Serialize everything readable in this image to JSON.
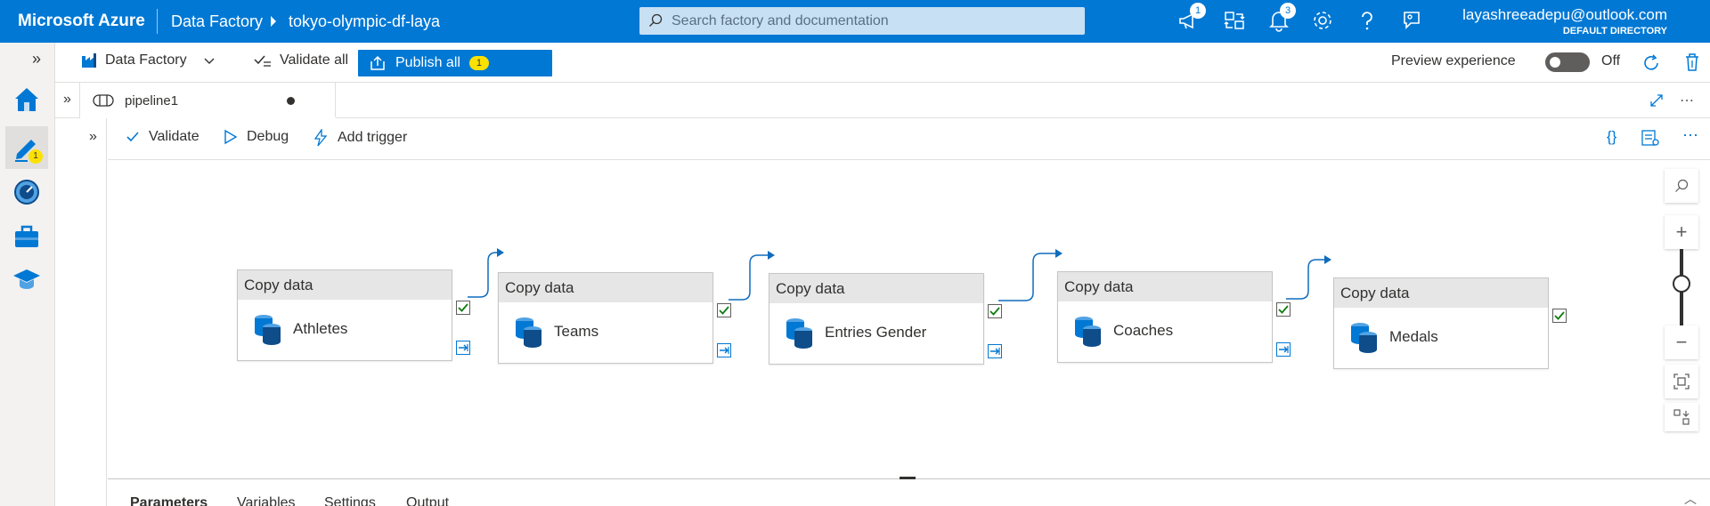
{
  "topbar": {
    "brand": "Microsoft Azure",
    "breadcrumb": [
      "Data Factory",
      "tokyo-olympic-df-laya"
    ],
    "search_placeholder": "Search factory and documentation",
    "notifications": {
      "updates_badge": "1",
      "bell_badge": "3"
    },
    "account": {
      "email": "layashreeadepu@outlook.com",
      "directory": "DEFAULT DIRECTORY"
    }
  },
  "rail": {
    "expand": "»",
    "items": [
      {
        "name": "home",
        "badge": ""
      },
      {
        "name": "author",
        "badge": "1"
      },
      {
        "name": "monitor",
        "badge": ""
      },
      {
        "name": "manage",
        "badge": ""
      },
      {
        "name": "learning-center",
        "badge": ""
      }
    ]
  },
  "commandbar": {
    "factory_label": "Data Factory",
    "validate_all": "Validate all",
    "publish_all": "Publish all",
    "publish_badge": "1",
    "preview_label": "Preview experience",
    "preview_state": "Off"
  },
  "tabs": {
    "expand": "»",
    "active_tab": "pipeline1"
  },
  "canvas_toolbar": {
    "expand": "»",
    "validate": "Validate",
    "debug": "Debug",
    "add_trigger": "Add trigger"
  },
  "activities": [
    {
      "type": "Copy data",
      "name": "Athletes"
    },
    {
      "type": "Copy data",
      "name": "Teams"
    },
    {
      "type": "Copy data",
      "name": "Entries Gender"
    },
    {
      "type": "Copy data",
      "name": "Coaches"
    },
    {
      "type": "Copy data",
      "name": "Medals"
    }
  ],
  "bottom_tabs": [
    "Parameters",
    "Variables",
    "Settings",
    "Output"
  ],
  "colors": {
    "azure_blue": "#0078d4",
    "badge_yellow": "#fce100",
    "success_green": "#107c10"
  }
}
